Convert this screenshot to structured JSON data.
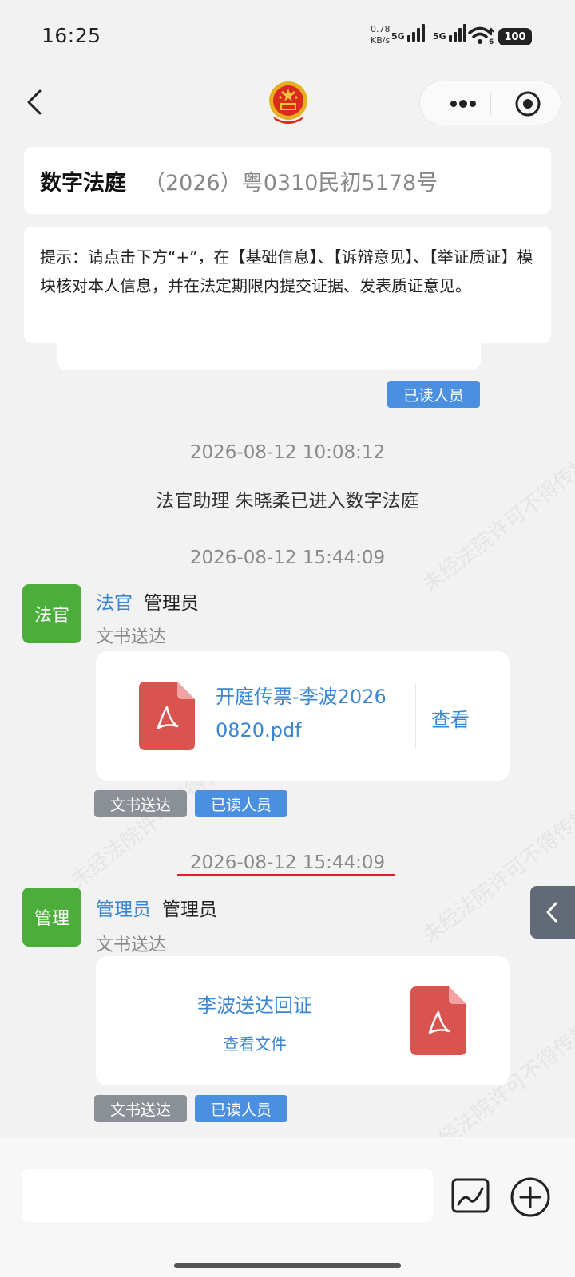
{
  "status": {
    "time": "16:25",
    "speed_value": "0.78",
    "speed_unit": "KB/s",
    "sim1": "5G",
    "sim2": "5G",
    "wifi_sub": "6",
    "battery": "100"
  },
  "header": {
    "emblem_icon": "national-emblem-icon",
    "title": "数字法庭",
    "case_no": "（2026）粤0310民初5178号"
  },
  "tip": "提示：请点击下方“+”，在【基础信息】、【诉辩意见】、【举证质证】模块核对本人信息，并在法定期限内提交证据、发表质证意见。",
  "chat": {
    "partial_tag": "已读人员",
    "ts1": "2026-08-12 10:08:12",
    "system_msg": "法官助理 朱晓柔已进入数字法庭",
    "ts2": "2026-08-12 15:44:09",
    "msg1": {
      "avatar": "法官",
      "role": "法官",
      "name": "管理员",
      "type": "文书送达",
      "file_line1": "开庭传票-李波2026",
      "file_line2": "0820.pdf",
      "view": "查看",
      "tag1": "文书送达",
      "tag2": "已读人员"
    },
    "ts3": "2026-08-12 15:44:09",
    "msg2": {
      "avatar": "管理",
      "role": "管理员",
      "name": "管理员",
      "type": "文书送达",
      "file_title": "李波送达回证",
      "view_file": "查看文件",
      "tag1": "文书送达",
      "tag2": "已读人员"
    }
  },
  "watermark": "未经法院许可不得传播",
  "colors": {
    "accent_blue": "#3a86d2",
    "avatar_green": "#4bae3b",
    "pdf_red": "#d9534f",
    "highlight_red": "#d9232a"
  }
}
